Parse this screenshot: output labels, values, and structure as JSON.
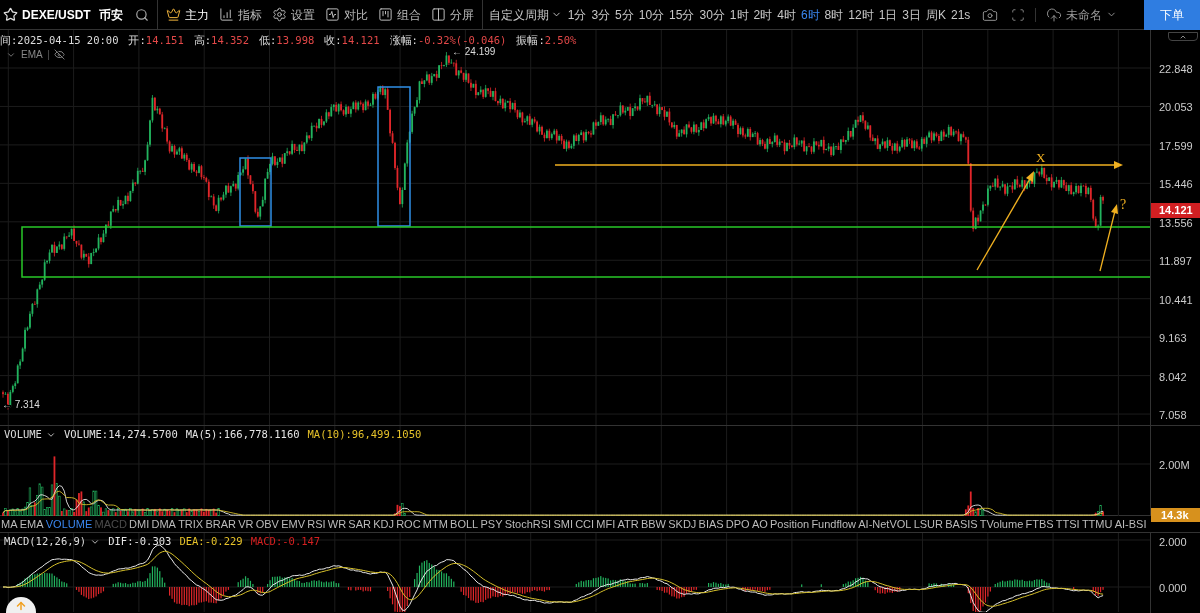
{
  "toolbar": {
    "symbol": "DEXE/USDT",
    "exchange": "币安",
    "tools": [
      {
        "label": "主力",
        "selected": true
      },
      {
        "label": "指标",
        "selected": false
      },
      {
        "label": "设置",
        "selected": false
      },
      {
        "label": "对比",
        "selected": false
      },
      {
        "label": "组合",
        "selected": false
      },
      {
        "label": "分屏",
        "selected": false
      }
    ],
    "period_menu": "自定义周期",
    "periods": [
      {
        "label": "1分",
        "selected": false
      },
      {
        "label": "3分",
        "selected": false
      },
      {
        "label": "5分",
        "selected": false
      },
      {
        "label": "10分",
        "selected": false
      },
      {
        "label": "15分",
        "selected": false
      },
      {
        "label": "30分",
        "selected": false
      },
      {
        "label": "1时",
        "selected": false
      },
      {
        "label": "2时",
        "selected": false
      },
      {
        "label": "4时",
        "selected": false
      },
      {
        "label": "6时",
        "selected": true
      },
      {
        "label": "8时",
        "selected": false
      },
      {
        "label": "12时",
        "selected": false
      },
      {
        "label": "1日",
        "selected": false
      },
      {
        "label": "3日",
        "selected": false
      },
      {
        "label": "周K",
        "selected": false
      },
      {
        "label": "21s",
        "selected": false
      }
    ],
    "layout_name": "未命名",
    "order_button": "下单"
  },
  "info_bar": [
    {
      "label": "间:",
      "value": "2025-04-15 20:00",
      "kind": "plain"
    },
    {
      "label": "开:",
      "value": "14.151",
      "kind": "price"
    },
    {
      "label": "高:",
      "value": "14.352",
      "kind": "price"
    },
    {
      "label": "低:",
      "value": "13.998",
      "kind": "price"
    },
    {
      "label": "收:",
      "value": "14.121",
      "kind": "price"
    },
    {
      "label": "涨幅:",
      "value": "-0.32%(-0.046)",
      "kind": "price"
    },
    {
      "label": "振幅:",
      "value": "2.50%",
      "kind": "price"
    }
  ],
  "overlay": {
    "indicator": "EMA"
  },
  "price_axis": {
    "ticks": [
      "22.848",
      "20.053",
      "17.599",
      "15.446",
      "13.556",
      "11.897",
      "10.441",
      "9.163",
      "8.042",
      "7.058"
    ],
    "last_price": "14.121"
  },
  "markers": {
    "high": "← 24.199",
    "low": "← 7.314"
  },
  "annotations": {
    "peak_label": "X",
    "question": "?"
  },
  "volume": {
    "name": "VOLUME",
    "readings": [
      {
        "text": "VOLUME:14,274.5700",
        "color": "#e5e5e5"
      },
      {
        "text": "MA(5):166,778.1160",
        "color": "#e5e5e5"
      },
      {
        "text": "MA(10):96,499.1050",
        "color": "#e6c229"
      }
    ],
    "axis_tick": "2.00M",
    "last": "14.3k"
  },
  "indicator_tabs": [
    {
      "label": "MA",
      "selected": false,
      "muted": false
    },
    {
      "label": "EMA",
      "selected": false,
      "muted": false
    },
    {
      "label": "VOLUME",
      "selected": true,
      "muted": false
    },
    {
      "label": "MACD",
      "selected": false,
      "muted": true
    },
    {
      "label": "DMI",
      "selected": false,
      "muted": false
    },
    {
      "label": "DMA",
      "selected": false,
      "muted": false
    },
    {
      "label": "TRIX",
      "selected": false,
      "muted": false
    },
    {
      "label": "BRAR",
      "selected": false,
      "muted": false
    },
    {
      "label": "VR",
      "selected": false,
      "muted": false
    },
    {
      "label": "OBV",
      "selected": false,
      "muted": false
    },
    {
      "label": "EMV",
      "selected": false,
      "muted": false
    },
    {
      "label": "RSI",
      "selected": false,
      "muted": false
    },
    {
      "label": "WR",
      "selected": false,
      "muted": false
    },
    {
      "label": "SAR",
      "selected": false,
      "muted": false
    },
    {
      "label": "KDJ",
      "selected": false,
      "muted": false
    },
    {
      "label": "ROC",
      "selected": false,
      "muted": false
    },
    {
      "label": "MTM",
      "selected": false,
      "muted": false
    },
    {
      "label": "BOLL",
      "selected": false,
      "muted": false
    },
    {
      "label": "PSY",
      "selected": false,
      "muted": false
    },
    {
      "label": "StochRSI",
      "selected": false,
      "muted": false
    },
    {
      "label": "SMI",
      "selected": false,
      "muted": false
    },
    {
      "label": "CCI",
      "selected": false,
      "muted": false
    },
    {
      "label": "MFI",
      "selected": false,
      "muted": false
    },
    {
      "label": "ATR",
      "selected": false,
      "muted": false
    },
    {
      "label": "BBW",
      "selected": false,
      "muted": false
    },
    {
      "label": "SKDJ",
      "selected": false,
      "muted": false
    },
    {
      "label": "BIAS",
      "selected": false,
      "muted": false
    },
    {
      "label": "DPO",
      "selected": false,
      "muted": false
    },
    {
      "label": "AO",
      "selected": false,
      "muted": false
    },
    {
      "label": "Position",
      "selected": false,
      "muted": false
    },
    {
      "label": "Fundflow",
      "selected": false,
      "muted": false
    },
    {
      "label": "AI-NetVOL",
      "selected": false,
      "muted": false
    },
    {
      "label": "LSUR",
      "selected": false,
      "muted": false
    },
    {
      "label": "BASIS",
      "selected": false,
      "muted": false
    },
    {
      "label": "TVolume",
      "selected": false,
      "muted": false
    },
    {
      "label": "FTBS",
      "selected": false,
      "muted": false
    },
    {
      "label": "TTSI",
      "selected": false,
      "muted": false
    },
    {
      "label": "TTMU",
      "selected": false,
      "muted": false
    },
    {
      "label": "AI-BSI",
      "selected": false,
      "muted": false
    }
  ],
  "macd": {
    "name": "MACD(12,26,9)",
    "readings": [
      {
        "text": "DIF:-0.303",
        "color": "#e5e5e5"
      },
      {
        "text": "DEA:-0.229",
        "color": "#e6c229"
      },
      {
        "text": "MACD:-0.147",
        "color": "#d42020"
      }
    ],
    "axis_ticks": [
      "2.000",
      "0.000"
    ]
  }
}
